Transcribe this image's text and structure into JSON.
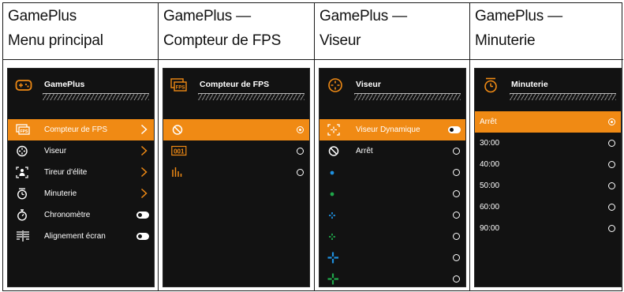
{
  "panels": [
    {
      "header_line1": "GamePlus",
      "header_line2": "Menu principal",
      "osd_title": "GamePlus",
      "rows": [
        {
          "label": "Compteur de FPS",
          "icon": "fps-counter-icon",
          "control": "chevron",
          "selected": true
        },
        {
          "label": "Viseur",
          "icon": "crosshair-icon",
          "control": "chevron",
          "selected": false
        },
        {
          "label": "Tireur d'élite",
          "icon": "sniper-icon",
          "control": "chevron",
          "selected": false
        },
        {
          "label": "Minuterie",
          "icon": "timer-icon",
          "control": "chevron",
          "selected": false
        },
        {
          "label": "Chronomètre",
          "icon": "stopwatch-icon",
          "control": "toggle",
          "selected": false
        },
        {
          "label": "Alignement écran",
          "icon": "display-alignment-icon",
          "control": "toggle",
          "selected": false
        }
      ]
    },
    {
      "header_line1": "GamePlus —",
      "header_line2": "Compteur de FPS",
      "osd_title": "Compteur de FPS",
      "rows": [
        {
          "label": "",
          "icon": "off-icon",
          "control": "radio",
          "checked": true,
          "selected": true
        },
        {
          "label": "",
          "icon": "fps-number-icon",
          "icon_text": "001",
          "control": "radio",
          "checked": false,
          "selected": false
        },
        {
          "label": "",
          "icon": "fps-bars-icon",
          "control": "radio",
          "checked": false,
          "selected": false
        }
      ]
    },
    {
      "header_line1": "GamePlus —",
      "header_line2": "Viseur",
      "osd_title": "Viseur",
      "rows": [
        {
          "label": "Viseur Dynamique",
          "icon": "dynamic-crosshair-icon",
          "control": "toggle",
          "selected": true
        },
        {
          "label": "Arrêt",
          "icon": "off-icon",
          "control": "radio",
          "checked": false,
          "selected": false
        },
        {
          "label": "",
          "icon": "blue-dot-icon",
          "control": "radio",
          "checked": false,
          "selected": false
        },
        {
          "label": "",
          "icon": "green-dot-icon",
          "control": "radio",
          "checked": false,
          "selected": false
        },
        {
          "label": "",
          "icon": "blue-small-cross-icon",
          "control": "radio",
          "checked": false,
          "selected": false
        },
        {
          "label": "",
          "icon": "green-small-cross-icon",
          "control": "radio",
          "checked": false,
          "selected": false
        },
        {
          "label": "",
          "icon": "blue-large-cross-icon",
          "control": "radio",
          "checked": false,
          "selected": false
        },
        {
          "label": "",
          "icon": "green-large-cross-icon",
          "control": "radio",
          "checked": false,
          "selected": false
        }
      ]
    },
    {
      "header_line1": "GamePlus —",
      "header_line2": "Minuterie",
      "osd_title": "Minuterie",
      "rows": [
        {
          "label": "Arrêt",
          "control": "radio",
          "checked": true,
          "selected": true
        },
        {
          "label": "30:00",
          "control": "radio",
          "checked": false,
          "selected": false
        },
        {
          "label": "40:00",
          "control": "radio",
          "checked": false,
          "selected": false
        },
        {
          "label": "50:00",
          "control": "radio",
          "checked": false,
          "selected": false
        },
        {
          "label": "60:00",
          "control": "radio",
          "checked": false,
          "selected": false
        },
        {
          "label": "90:00",
          "control": "radio",
          "checked": false,
          "selected": false
        }
      ]
    }
  ],
  "colors": {
    "highlight": "#f08a14",
    "crosshair_blue": "#1e90e0",
    "crosshair_green": "#1fa74a",
    "osd_background": "#121212"
  }
}
